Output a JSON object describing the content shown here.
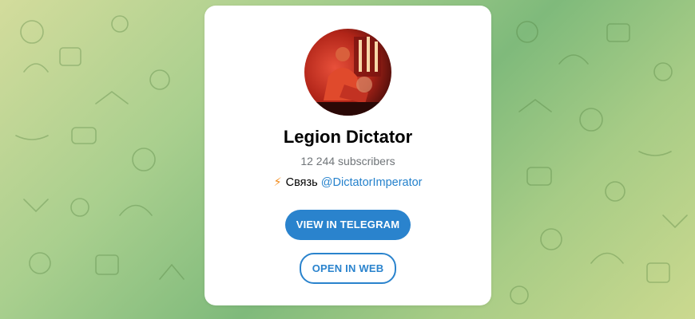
{
  "channel": {
    "name": "Legion Dictator",
    "subscribers": "12 244 subscribers",
    "description": {
      "icon": "lightning-icon",
      "icon_glyph": "⚡",
      "text": "Связь",
      "link": "@DictatorImperator"
    }
  },
  "actions": {
    "view_in_telegram": "VIEW IN TELEGRAM",
    "open_in_web": "OPEN IN WEB"
  },
  "colors": {
    "accent": "#2a83cd",
    "link": "#2481cc",
    "subtitle": "#707579",
    "bolt": "#f28b1c",
    "card": "#ffffff"
  }
}
